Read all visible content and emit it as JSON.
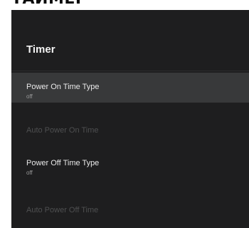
{
  "page_heading": "ТАЙМЕР",
  "panel": {
    "title": "Timer",
    "items": [
      {
        "label": "Power On Time Type",
        "value": "off",
        "state": "focused"
      },
      {
        "label": "Auto Power On Time",
        "value": "",
        "state": "disabled"
      },
      {
        "label": "Power Off Time Type",
        "value": "off",
        "state": "enabled"
      },
      {
        "label": "Auto Power Off Time",
        "value": "",
        "state": "disabled"
      }
    ]
  },
  "colors": {
    "panel_background": "#1e1e1f",
    "focused_row": "#38393a",
    "text_primary": "#e9e9e9",
    "text_disabled": "#4e4f50"
  }
}
